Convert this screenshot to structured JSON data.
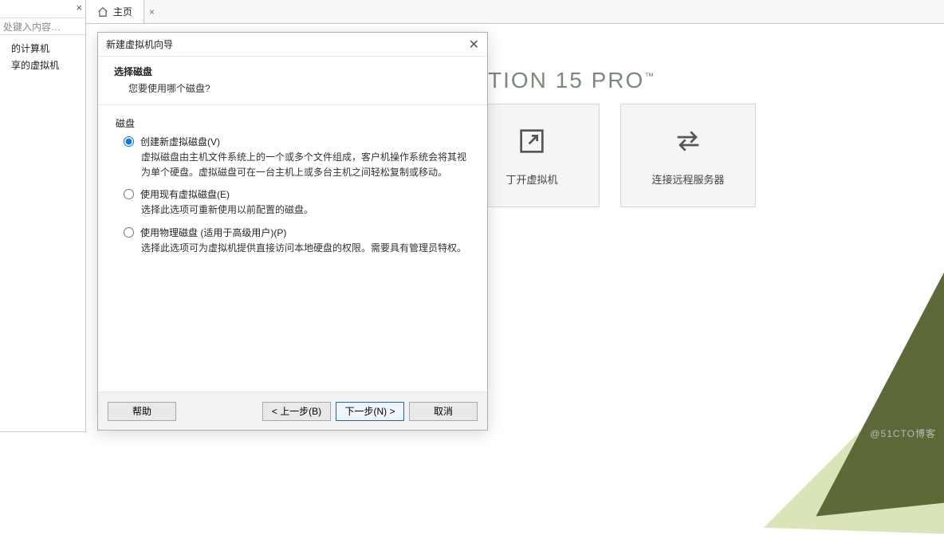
{
  "sidebar": {
    "search_placeholder": "处键入内容…",
    "items": [
      {
        "label": "的计算机"
      },
      {
        "label": "享的虚拟机"
      }
    ]
  },
  "tabs": [
    {
      "label": "主页"
    }
  ],
  "brand": {
    "text_a": "TION 15 ",
    "text_b": "PRO",
    "tm": "™"
  },
  "cards": {
    "open_vm": "丁开虚拟机",
    "connect_remote": "连接远程服务器"
  },
  "dialog": {
    "window_title": "新建虚拟机向导",
    "head_title": "选择磁盘",
    "head_sub": "您要使用哪个磁盘?",
    "group_label": "磁盘",
    "options": [
      {
        "label": "创建新虚拟磁盘(V)",
        "desc": "虚拟磁盘由主机文件系统上的一个或多个文件组成，客户机操作系统会将其视为单个硬盘。虚拟磁盘可在一台主机上或多台主机之间轻松复制或移动。",
        "checked": true
      },
      {
        "label": "使用现有虚拟磁盘(E)",
        "desc": "选择此选项可重新使用以前配置的磁盘。",
        "checked": false
      },
      {
        "label": "使用物理磁盘 (适用于高级用户)(P)",
        "desc": "选择此选项可为虚拟机提供直接访问本地硬盘的权限。需要具有管理员特权。",
        "checked": false
      }
    ],
    "buttons": {
      "help": "帮助",
      "back": "< 上一步(B)",
      "next": "下一步(N) >",
      "cancel": "取消"
    }
  },
  "watermark": "@51CTO博客"
}
